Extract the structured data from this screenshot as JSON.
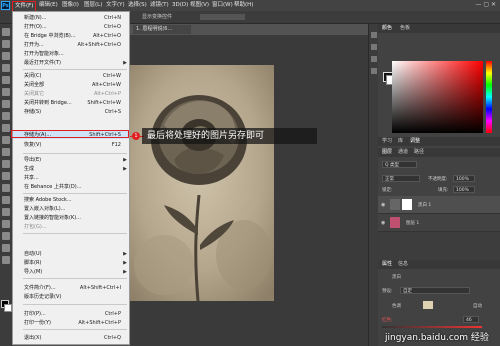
{
  "menubar": {
    "logo": "Ps",
    "items": [
      "文件(F)",
      "编辑(E)",
      "图像(I)",
      "图层(L)",
      "文字(Y)",
      "选择(S)",
      "滤镜(T)",
      "3D(D)",
      "视图(V)",
      "窗口(W)",
      "帮助(H)"
    ]
  },
  "optionsbar": {
    "text": "显示变换控件"
  },
  "document": {
    "tab": "1. 眉程明锐(6…"
  },
  "file_menu": {
    "items": [
      {
        "label": "新建(N)...",
        "shortcut": "Ctrl+N"
      },
      {
        "label": "打开(O)...",
        "shortcut": "Ctrl+O"
      },
      {
        "label": "在 Bridge 中浏览(B)...",
        "shortcut": "Alt+Ctrl+O"
      },
      {
        "label": "打开为...",
        "shortcut": "Alt+Shift+Ctrl+O"
      },
      {
        "label": "打开为智能对象...",
        "shortcut": ""
      },
      {
        "label": "最近打开文件(T)",
        "shortcut": ""
      },
      {
        "label": "关闭(C)",
        "shortcut": "Ctrl+W"
      },
      {
        "label": "关闭全部",
        "shortcut": "Alt+Ctrl+W"
      },
      {
        "label": "关闭其它",
        "shortcut": "Alt+Ctrl+P"
      },
      {
        "label": "关闭并转到 Bridge...",
        "shortcut": "Shift+Ctrl+W"
      },
      {
        "label": "存储(S)",
        "shortcut": "Ctrl+S"
      },
      {
        "label": "存储为(A)...",
        "shortcut": "Shift+Ctrl+S"
      },
      {
        "label": "恢复(V)",
        "shortcut": "F12"
      },
      {
        "label": "导出(E)",
        "shortcut": ""
      },
      {
        "label": "生成",
        "shortcut": ""
      },
      {
        "label": "共享...",
        "shortcut": ""
      },
      {
        "label": "在 Behance 上共享(D)...",
        "shortcut": ""
      },
      {
        "label": "搜索 Adobe Stock...",
        "shortcut": ""
      },
      {
        "label": "置入嵌入对象(L)...",
        "shortcut": ""
      },
      {
        "label": "置入链接的智能对象(K)...",
        "shortcut": ""
      },
      {
        "label": "打包(G)...",
        "shortcut": ""
      },
      {
        "label": "自动(U)",
        "shortcut": ""
      },
      {
        "label": "脚本(R)",
        "shortcut": ""
      },
      {
        "label": "导入(M)",
        "shortcut": ""
      },
      {
        "label": "文件简介(F)...",
        "shortcut": "Alt+Shift+Ctrl+I"
      },
      {
        "label": "版本历史记录(V)",
        "shortcut": ""
      },
      {
        "label": "打印(P)...",
        "shortcut": "Ctrl+P"
      },
      {
        "label": "打印一份(Y)",
        "shortcut": "Alt+Shift+Ctrl+P"
      },
      {
        "label": "退出(X)",
        "shortcut": "Ctrl+Q"
      }
    ]
  },
  "callout": {
    "badge": "1",
    "text": "最后将处理好的图片另存即可"
  },
  "panels": {
    "color_tabs": [
      "颜色",
      "色板"
    ],
    "adjust_tabs": [
      "学习",
      "库",
      "调整"
    ],
    "layers_tabs": [
      "图层",
      "通道",
      "路径"
    ],
    "kind": "Q 类型",
    "blend": "正常",
    "opacity_label": "不透明度:",
    "opacity_value": "100%",
    "lock_label": "锁定:",
    "fill_label": "填充:",
    "fill_value": "100%",
    "layer1": "黑白 1",
    "layer2": "图层 1",
    "props_tabs": [
      "属性",
      "信息"
    ],
    "props_title": "黑白",
    "preset": "预设:",
    "preset_value": "自定",
    "tint": "色调",
    "auto": "自动",
    "red_label": "红色:",
    "red_value": "46"
  },
  "watermark": "jingyan.baidu.com 经验"
}
